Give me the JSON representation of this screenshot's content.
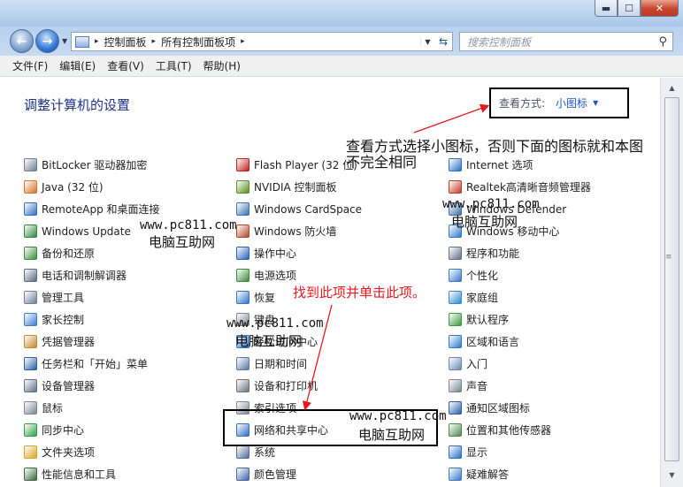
{
  "window": {
    "controls": {
      "minimize": "▬",
      "maximize": "☐",
      "close": "✕"
    }
  },
  "address_bar": {
    "breadcrumbs": [
      "控制面板",
      "所有控制面板项"
    ],
    "search_placeholder": "搜索控制面板"
  },
  "menu": [
    "文件(F)",
    "编辑(E)",
    "查看(V)",
    "工具(T)",
    "帮助(H)"
  ],
  "main": {
    "heading": "调整计算机的设置",
    "view_by_label": "查看方式:",
    "view_by_value": "小图标"
  },
  "columns": [
    {
      "items": [
        {
          "label": "BitLocker 驱动器加密",
          "color": "#6d7f96"
        },
        {
          "label": "Java (32 位)",
          "color": "#d8742a"
        },
        {
          "label": "RemoteApp 和桌面连接",
          "color": "#2f6fc4"
        },
        {
          "label": "Windows Update",
          "color": "#2f8a3c"
        },
        {
          "label": "备份和还原",
          "color": "#3a8e3a"
        },
        {
          "label": "电话和调制解调器",
          "color": "#5a6a80"
        },
        {
          "label": "管理工具",
          "color": "#6b7f9a"
        },
        {
          "label": "家长控制",
          "color": "#3d7bd0"
        },
        {
          "label": "凭据管理器",
          "color": "#c28a2a"
        },
        {
          "label": "任务栏和「开始」菜单",
          "color": "#2a5faa"
        },
        {
          "label": "设备管理器",
          "color": "#5f7088"
        },
        {
          "label": "鼠标",
          "color": "#7b8592"
        },
        {
          "label": "同步中心",
          "color": "#2fa04a"
        },
        {
          "label": "文件夹选项",
          "color": "#d9a520"
        },
        {
          "label": "性能信息和工具",
          "color": "#3a6a3a"
        }
      ]
    },
    {
      "items": [
        {
          "label": "Flash Player (32 位)",
          "color": "#c3201a"
        },
        {
          "label": "NVIDIA 控制面板",
          "color": "#5a8e1e"
        },
        {
          "label": "Windows CardSpace",
          "color": "#3c6fb3"
        },
        {
          "label": "Windows 防火墙",
          "color": "#b04a2a"
        },
        {
          "label": "操作中心",
          "color": "#2660b8"
        },
        {
          "label": "电源选项",
          "color": "#3a8a3a"
        },
        {
          "label": "恢复",
          "color": "#2f76c8"
        },
        {
          "label": "键盘",
          "color": "#7d8592"
        },
        {
          "label": "轻松访问中心",
          "color": "#2f6fc4"
        },
        {
          "label": "日期和时间",
          "color": "#5a7aa5"
        },
        {
          "label": "设备和打印机",
          "color": "#6a7280"
        },
        {
          "label": "索引选项",
          "color": "#7a8896"
        },
        {
          "label": "网络和共享中心",
          "color": "#2f6fc4"
        },
        {
          "label": "系统",
          "color": "#4f6f9a"
        },
        {
          "label": "颜色管理",
          "color": "#3f66a5"
        }
      ]
    },
    {
      "items": [
        {
          "label": "Internet 选项",
          "color": "#2f6fc4"
        },
        {
          "label": "Realtek高清晰音频管理器",
          "color": "#c43a2a"
        },
        {
          "label": "Windows Defender",
          "color": "#3d6fa8"
        },
        {
          "label": "Windows 移动中心",
          "color": "#2f7ac8"
        },
        {
          "label": "程序和功能",
          "color": "#5f7088"
        },
        {
          "label": "个性化",
          "color": "#3a78c9"
        },
        {
          "label": "家庭组",
          "color": "#2f8acf"
        },
        {
          "label": "默认程序",
          "color": "#3a9a3a"
        },
        {
          "label": "区域和语言",
          "color": "#2f7ac8"
        },
        {
          "label": "入门",
          "color": "#6a88b8"
        },
        {
          "label": "声音",
          "color": "#7a8696"
        },
        {
          "label": "通知区域图标",
          "color": "#2a5faa"
        },
        {
          "label": "位置和其他传感器",
          "color": "#4a8a4a"
        },
        {
          "label": "显示",
          "color": "#2f6fc4"
        },
        {
          "label": "疑难解答",
          "color": "#3a7ac8"
        }
      ]
    }
  ],
  "annotations": {
    "view_hint_line1": "查看方式选择小图标，否则下面的图标就和本图",
    "view_hint_line2": "不完全相同",
    "click_hint": "找到此项并单击此项。",
    "watermark_url": "www.pc811.com",
    "watermark_cn": "电脑互助网"
  }
}
